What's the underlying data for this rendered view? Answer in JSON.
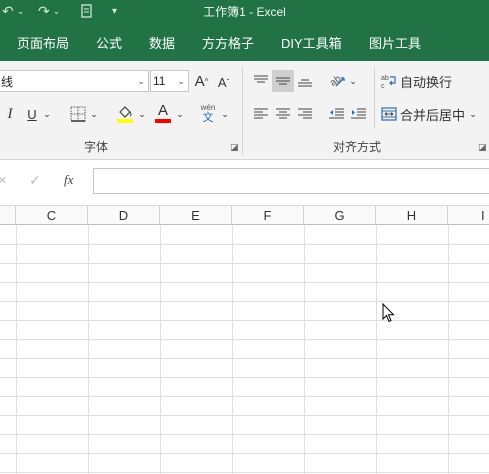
{
  "app": {
    "title": "工作簿1 - Excel",
    "undo_icon": "undo-icon",
    "redo_icon": "redo-icon",
    "touch_icon": "touch-mode-icon",
    "customize_icon": "customize-toolbar-icon"
  },
  "tabs": [
    "页面布局",
    "公式",
    "数据",
    "方方格子",
    "DIY工具箱",
    "图片工具"
  ],
  "font": {
    "name": "线",
    "size": "11",
    "grow": "A",
    "shrink": "A",
    "italic": "I",
    "underline": "U",
    "font_color_letter": "A",
    "wen_top": "wén",
    "wen_bottom": "文",
    "group_label": "字体"
  },
  "align": {
    "wrap_text": "自动换行",
    "merge_center": "合并后居中",
    "group_label": "对齐方式"
  },
  "formula_bar": {
    "cancel": "×",
    "enter": "✓",
    "fx": "fx",
    "value": ""
  },
  "columns": [
    "C",
    "D",
    "E",
    "F",
    "G",
    "H",
    "I"
  ],
  "colors": {
    "brand": "#217346",
    "fill_color": "#ffff00",
    "font_color": "#ff0000"
  }
}
